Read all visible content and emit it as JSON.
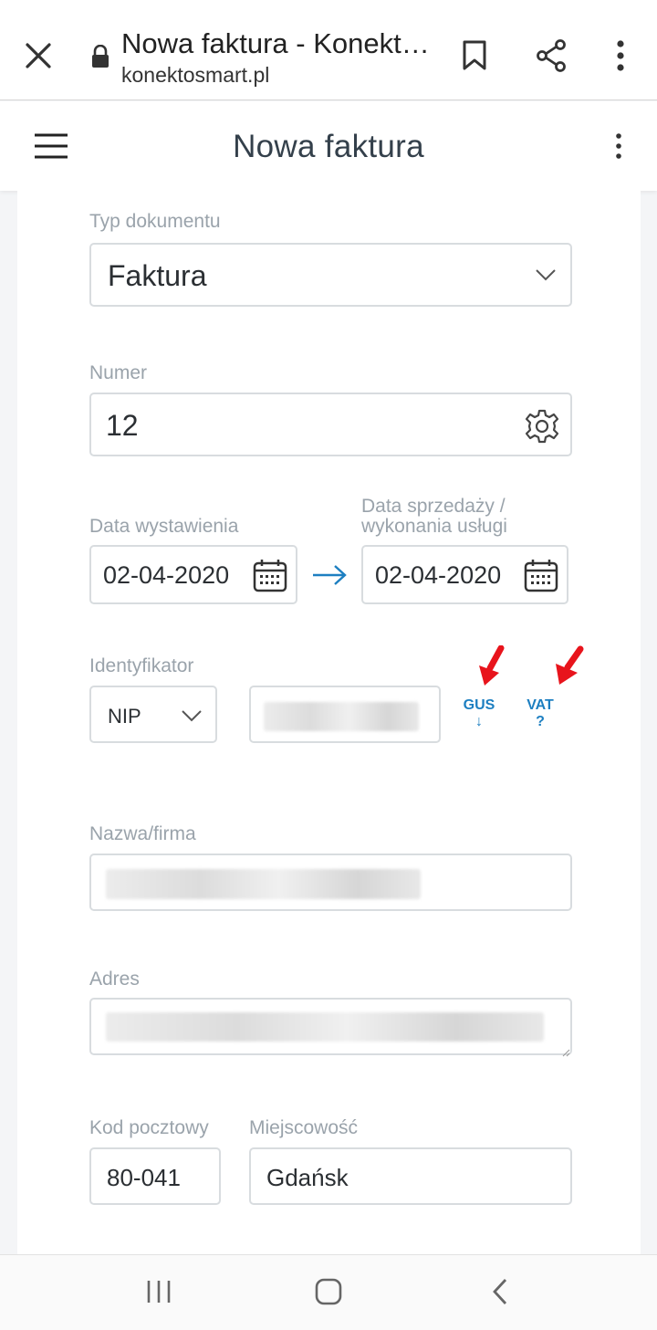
{
  "browser": {
    "title": "Nowa faktura - Konekt…",
    "url": "konektosmart.pl"
  },
  "header": {
    "title": "Nowa faktura"
  },
  "form": {
    "doc_type": {
      "label": "Typ dokumentu",
      "value": "Faktura"
    },
    "number": {
      "label": "Numer",
      "value": "12"
    },
    "issue_date": {
      "label": "Data wystawienia",
      "value": "02-04-2020"
    },
    "sale_date": {
      "label_line1": "Data sprzedaży /",
      "label_line2": "wykonania usługi",
      "value": "02-04-2020"
    },
    "identifier": {
      "label": "Identyfikator",
      "type_value": "NIP",
      "gus_label": "GUS",
      "gus_symbol": "↓",
      "vat_label": "VAT",
      "vat_symbol": "?"
    },
    "name": {
      "label": "Nazwa/firma"
    },
    "address": {
      "label": "Adres"
    },
    "postal_code": {
      "label": "Kod pocztowy",
      "value": "80-041"
    },
    "city": {
      "label": "Miejscowość",
      "value": "Gdańsk"
    }
  },
  "colors": {
    "accent": "#1d7fc1",
    "annotation_arrow": "#e8141c"
  }
}
